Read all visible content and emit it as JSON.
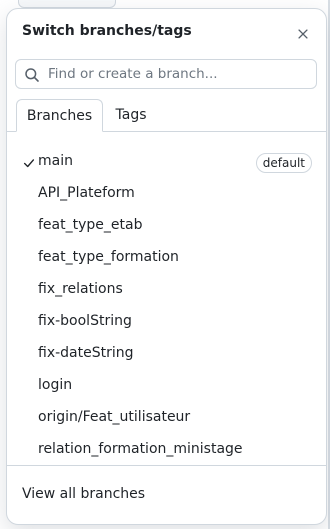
{
  "dialog": {
    "title": "Switch branches/tags",
    "close_icon": "close-icon"
  },
  "search": {
    "value": "",
    "placeholder": "Find or create a branch...",
    "icon": "search-icon"
  },
  "tabs": [
    {
      "label": "Branches",
      "active": true
    },
    {
      "label": "Tags",
      "active": false
    }
  ],
  "branches": [
    {
      "name": "main",
      "selected": true,
      "badge": "default"
    },
    {
      "name": "API_Plateform",
      "selected": false
    },
    {
      "name": "feat_type_etab",
      "selected": false
    },
    {
      "name": "feat_type_formation",
      "selected": false
    },
    {
      "name": "fix_relations",
      "selected": false
    },
    {
      "name": "fix-boolString",
      "selected": false
    },
    {
      "name": "fix-dateString",
      "selected": false
    },
    {
      "name": "login",
      "selected": false
    },
    {
      "name": "origin/Feat_utilisateur",
      "selected": false
    },
    {
      "name": "relation_formation_ministage",
      "selected": false
    }
  ],
  "footer": {
    "link_label": "View all branches"
  },
  "colors": {
    "text": "#1f2328",
    "muted": "#6e7781",
    "border": "#d0d7de",
    "background": "#ffffff"
  }
}
